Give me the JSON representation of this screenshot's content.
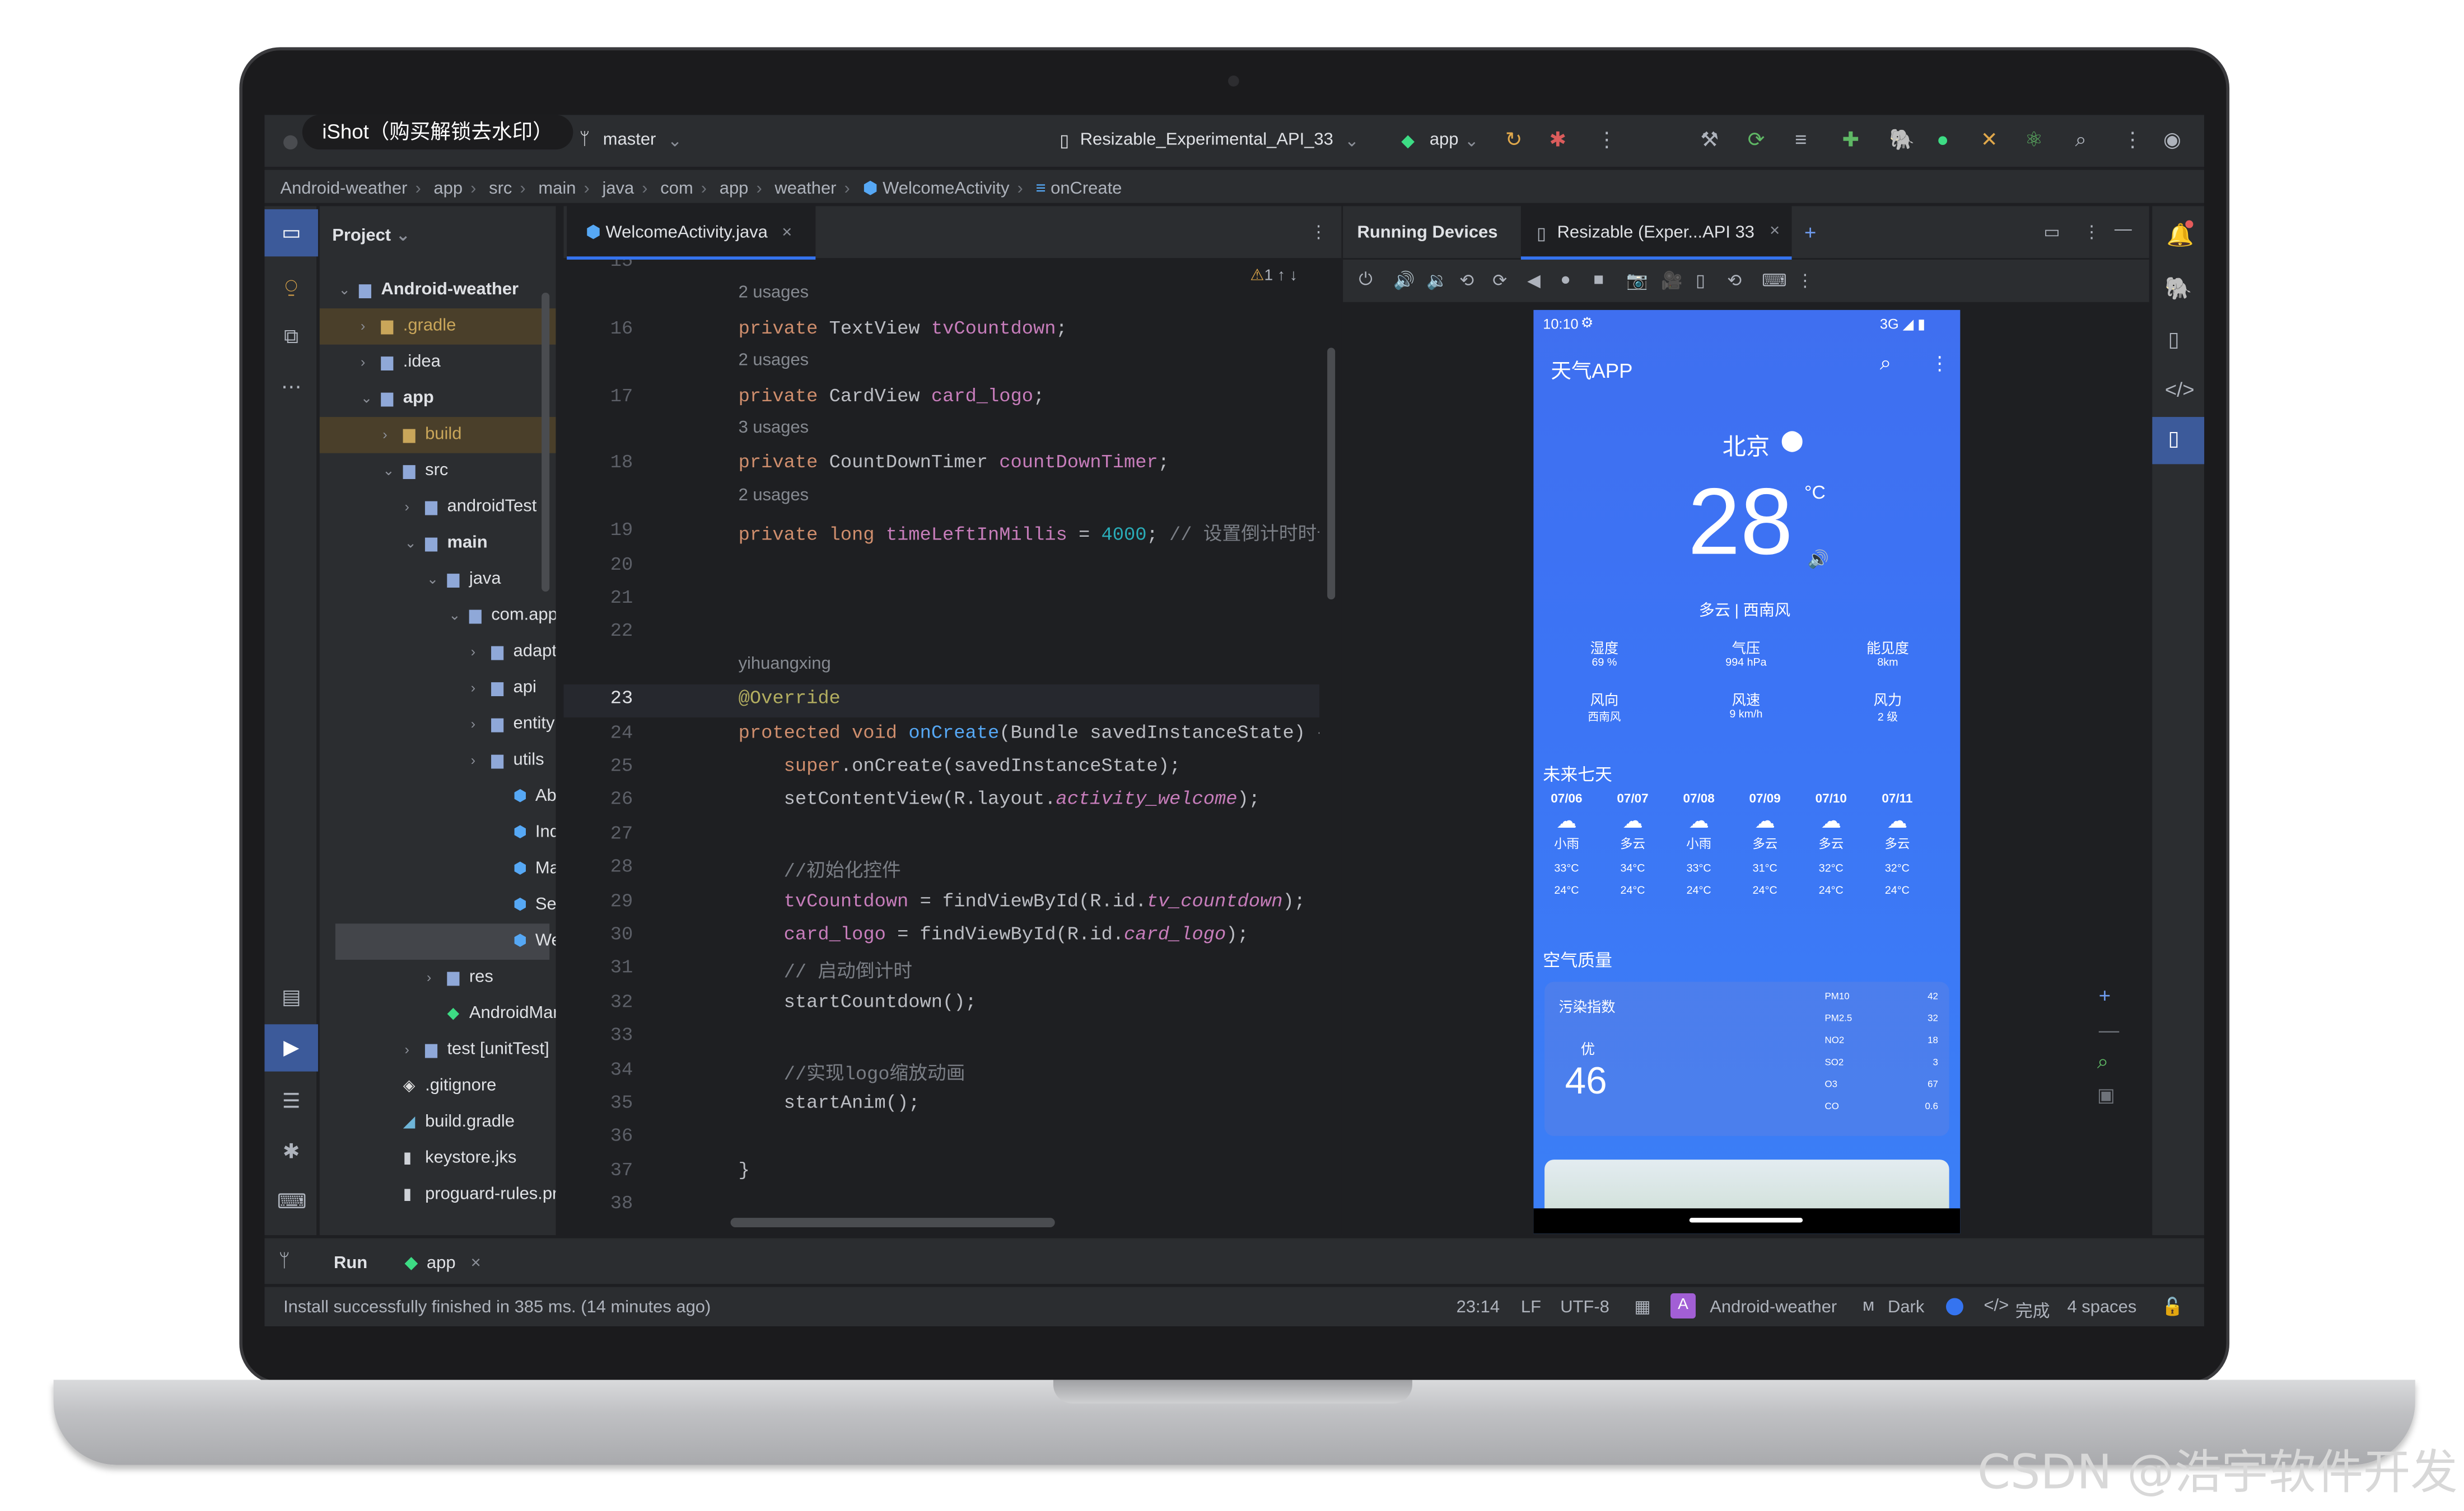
{
  "watermark_top": "iShot（购买解锁去水印）",
  "watermark_bottom": "CSDN @浩宇软件开发",
  "titlebar": {
    "branch": "master",
    "device": "Resizable_Experimental_API_33",
    "run_config": "app"
  },
  "breadcrumb": [
    "Android-weather",
    "app",
    "src",
    "main",
    "java",
    "com",
    "app",
    "weather",
    "WelcomeActivity",
    "onCreate"
  ],
  "project": {
    "title": "Project",
    "items": [
      {
        "label": "Android-weather",
        "indent": 0,
        "arrow": "v",
        "icon": "folder"
      },
      {
        "label": ".gradle",
        "indent": 1,
        "arrow": ">",
        "icon": "folder",
        "muted": true
      },
      {
        "label": ".idea",
        "indent": 1,
        "arrow": ">",
        "icon": "folder"
      },
      {
        "label": "app",
        "indent": 1,
        "arrow": "v",
        "icon": "folder"
      },
      {
        "label": "build",
        "indent": 2,
        "arrow": ">",
        "icon": "folder",
        "muted": true
      },
      {
        "label": "src",
        "indent": 2,
        "arrow": "v",
        "icon": "folder"
      },
      {
        "label": "androidTest",
        "indent": 3,
        "arrow": ">",
        "icon": "folder"
      },
      {
        "label": "main",
        "indent": 3,
        "arrow": "v",
        "icon": "folder"
      },
      {
        "label": "java",
        "indent": 4,
        "arrow": "v",
        "icon": "folder"
      },
      {
        "label": "com.app",
        "indent": 5,
        "arrow": "v",
        "icon": "folder"
      },
      {
        "label": "adapter",
        "indent": 6,
        "arrow": ">",
        "icon": "folder"
      },
      {
        "label": "api",
        "indent": 6,
        "arrow": ">",
        "icon": "folder"
      },
      {
        "label": "entity",
        "indent": 6,
        "arrow": ">",
        "icon": "folder"
      },
      {
        "label": "utils",
        "indent": 6,
        "arrow": ">",
        "icon": "folder"
      },
      {
        "label": "AboutActivity",
        "indent": 7,
        "arrow": "",
        "icon": "class"
      },
      {
        "label": "IndicatorActivity",
        "indent": 7,
        "arrow": "",
        "icon": "class"
      },
      {
        "label": "MainActivity",
        "indent": 7,
        "arrow": "",
        "icon": "class"
      },
      {
        "label": "SearchActivity",
        "indent": 7,
        "arrow": "",
        "icon": "class"
      },
      {
        "label": "WelcomeActivity",
        "indent": 7,
        "arrow": "",
        "icon": "class",
        "selected": true
      },
      {
        "label": "res",
        "indent": 4,
        "arrow": ">",
        "icon": "folder"
      },
      {
        "label": "AndroidManifest.xml",
        "indent": 4,
        "arrow": "",
        "icon": "android"
      },
      {
        "label": "test [unitTest]",
        "indent": 3,
        "arrow": ">",
        "icon": "folder"
      },
      {
        "label": ".gitignore",
        "indent": 2,
        "arrow": "",
        "icon": "git"
      },
      {
        "label": "build.gradle",
        "indent": 2,
        "arrow": "",
        "icon": "gradle"
      },
      {
        "label": "keystore.jks",
        "indent": 2,
        "arrow": "",
        "icon": "file"
      },
      {
        "label": "proguard-rules.pro",
        "indent": 2,
        "arrow": "",
        "icon": "file"
      }
    ]
  },
  "editor": {
    "tab": "WelcomeActivity.java",
    "warnings": "1",
    "lines": [
      {
        "n": "15",
        "html": ""
      },
      {
        "hint": "2 usages"
      },
      {
        "n": "16",
        "html": "<span class='kw'>private</span> TextView <span class='fd'>tvCountdown</span>;"
      },
      {
        "hint": "2 usages"
      },
      {
        "n": "17",
        "html": "<span class='kw'>private</span> CardView <span class='fd'>card_logo</span>;"
      },
      {
        "hint": "3 usages"
      },
      {
        "n": "18",
        "html": "<span class='kw'>private</span> CountDownTimer <span class='fd'>countDownTimer</span>;"
      },
      {
        "hint": "2 usages"
      },
      {
        "n": "19",
        "html": "<span class='kw'>private long</span> <span class='fd'>timeLeftInMillis</span> = <span class='num'>4000</span>; <span class='cm'>// 设置倒计时时长</span>"
      },
      {
        "n": "20",
        "html": ""
      },
      {
        "n": "21",
        "html": ""
      },
      {
        "n": "22",
        "html": ""
      },
      {
        "hint": "yihuangxing"
      },
      {
        "n": "23",
        "html": "<span class='ann'>@Override</span>"
      },
      {
        "n": "24",
        "html": "<span class='kw'>protected void</span> <span class='fn'>onCreate</span>(Bundle savedInstanceState) {"
      },
      {
        "n": "25",
        "html": "    <span class='kw'>super</span>.onCreate(savedInstanceState);"
      },
      {
        "n": "26",
        "html": "    setContentView(R.layout.<span class='it'>activity_welcome</span>);"
      },
      {
        "n": "27",
        "html": ""
      },
      {
        "n": "28",
        "html": "    <span class='cm'>//初始化控件</span>"
      },
      {
        "n": "29",
        "html": "    <span class='fd'>tvCountdown</span> = findViewById(R.id.<span class='it'>tv_countdown</span>);"
      },
      {
        "n": "30",
        "html": "    <span class='fd'>card_logo</span> = findViewById(R.id.<span class='it'>card_logo</span>);"
      },
      {
        "n": "31",
        "html": "    <span class='cm'>// 启动倒计时</span>"
      },
      {
        "n": "32",
        "html": "    startCountdown();"
      },
      {
        "n": "33",
        "html": ""
      },
      {
        "n": "34",
        "html": "    <span class='cm'>//实现logo缩放动画</span>"
      },
      {
        "n": "35",
        "html": "    startAnim();"
      },
      {
        "n": "36",
        "html": ""
      },
      {
        "n": "37",
        "html": "}"
      },
      {
        "n": "38",
        "html": ""
      }
    ]
  },
  "running": {
    "title": "Running Devices",
    "tab": "Resizable (Exper...API 33"
  },
  "phone": {
    "time": "10:10",
    "net": "3G",
    "app_title": "天气APP",
    "city": "北京",
    "temp": "28",
    "unit": "°C",
    "desc": "多云 | 西南风",
    "stats": [
      {
        "k": "湿度",
        "v": "69 %"
      },
      {
        "k": "气压",
        "v": "994 hPa"
      },
      {
        "k": "能见度",
        "v": "8km"
      },
      {
        "k": "风向",
        "v": "西南风"
      },
      {
        "k": "风速",
        "v": "9 km/h"
      },
      {
        "k": "风力",
        "v": "2 级"
      }
    ],
    "forecast_title": "未来七天",
    "forecast": [
      {
        "d": "07/06",
        "w": "小雨",
        "hi": "33°C",
        "lo": "24°C"
      },
      {
        "d": "07/07",
        "w": "多云",
        "hi": "34°C",
        "lo": "24°C"
      },
      {
        "d": "07/08",
        "w": "小雨",
        "hi": "33°C",
        "lo": "24°C"
      },
      {
        "d": "07/09",
        "w": "多云",
        "hi": "31°C",
        "lo": "24°C"
      },
      {
        "d": "07/10",
        "w": "多云",
        "hi": "32°C",
        "lo": "24°C"
      },
      {
        "d": "07/11",
        "w": "多云",
        "hi": "32°C",
        "lo": "24°C"
      }
    ],
    "aq_title": "空气质量",
    "aq_label": "污染指数",
    "aq_level": "优",
    "aq_value": "46",
    "aq": [
      {
        "k": "PM10",
        "v": "42"
      },
      {
        "k": "PM2.5",
        "v": "32"
      },
      {
        "k": "NO2",
        "v": "18"
      },
      {
        "k": "SO2",
        "v": "3"
      },
      {
        "k": "O3",
        "v": "67"
      },
      {
        "k": "CO",
        "v": "0.6"
      }
    ]
  },
  "run": {
    "label": "Run",
    "config": "app"
  },
  "status": {
    "message": "Install successfully finished in 385 ms. (14 minutes ago)",
    "pos": "23:14",
    "le": "LF",
    "enc": "UTF-8",
    "project": "Android-weather",
    "theme": "Dark",
    "done": "完成",
    "indent": "4 spaces"
  }
}
